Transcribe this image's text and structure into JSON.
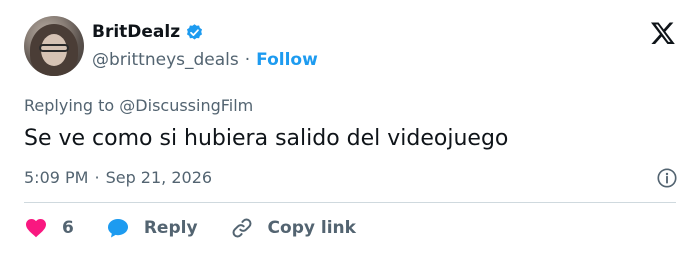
{
  "author": {
    "display_name": "BritDealz",
    "handle": "@brittneys_deals",
    "separator": "·",
    "follow_label": "Follow"
  },
  "reply_context": {
    "prefix": "Replying to",
    "mention": "@DiscussingFilm"
  },
  "tweet": {
    "text": "Se ve como si hubiera salido del videojuego",
    "time": "5:09 PM",
    "separator": "·",
    "date": "Sep 21, 2026"
  },
  "actions": {
    "like_count": "6",
    "reply_label": "Reply",
    "copy_link_label": "Copy link"
  },
  "colors": {
    "accent": "#1d9bf0",
    "like": "#f91880",
    "text": "#0f1419",
    "muted": "#536471",
    "divider": "#cfd9de"
  },
  "icons": [
    "verified-badge-icon",
    "x-logo-icon",
    "info-icon",
    "heart-icon",
    "reply-bubble-icon",
    "link-icon"
  ]
}
